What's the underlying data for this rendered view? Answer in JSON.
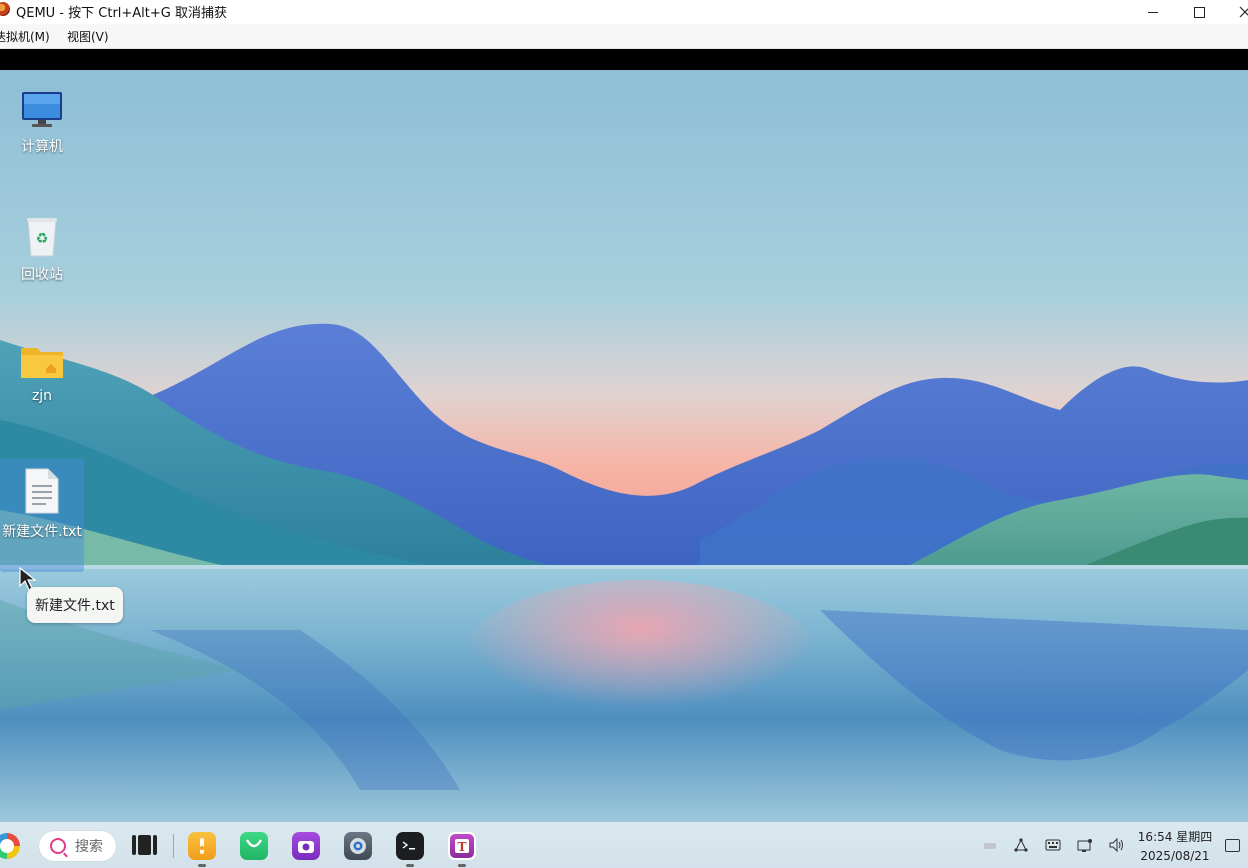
{
  "window": {
    "title": "QEMU - 按下 Ctrl+Alt+G 取消捕获",
    "controls": [
      "minimize",
      "maximize",
      "close"
    ]
  },
  "menubar": {
    "items": [
      {
        "label": "虚拟机(M)",
        "visible_label": "迭拟机(M)"
      },
      {
        "label": "视图(V)"
      }
    ]
  },
  "desktop": {
    "icons": [
      {
        "label": "计算机",
        "icon": "computer-icon"
      },
      {
        "label": "回收站",
        "icon": "recycle-bin-icon"
      },
      {
        "label": "zjn",
        "icon": "home-folder-icon"
      },
      {
        "label": "新建文件.txt",
        "icon": "text-file-icon",
        "selected": true
      }
    ],
    "tooltip": "新建文件.txt"
  },
  "taskbar": {
    "search_placeholder": "搜索",
    "apps": [
      {
        "name": "file-manager",
        "color": "#f5a623"
      },
      {
        "name": "app-store",
        "color": "#27c46b"
      },
      {
        "name": "screenshot",
        "color": "#8e44ad"
      },
      {
        "name": "settings",
        "color": "#555e6b"
      },
      {
        "name": "terminal",
        "color": "#1e1e1e"
      },
      {
        "name": "text-editor",
        "color": "#a33aa8"
      }
    ],
    "clock": {
      "time": "16:54 星期四",
      "date": "2025/08/21"
    }
  }
}
